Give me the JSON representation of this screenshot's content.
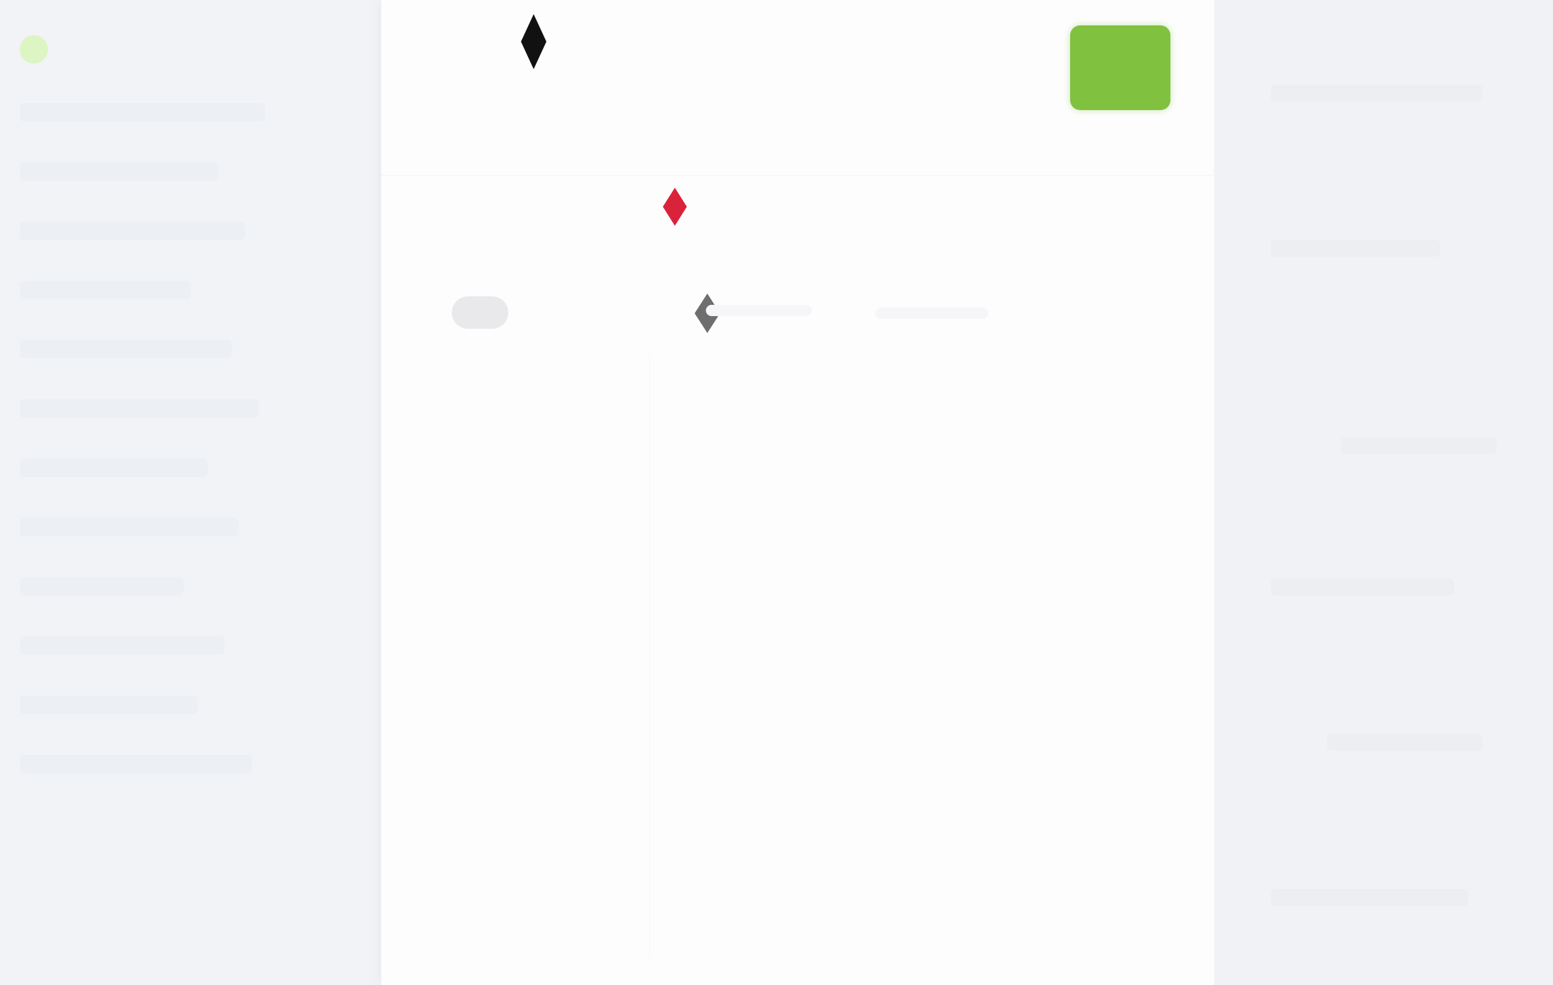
{
  "app": {
    "brand_color": "#d8f5b8"
  },
  "colors": {
    "accent_green": "#80c140",
    "alert_red": "#d9233a",
    "icon_dark": "#111111",
    "icon_gray": "#6e6e6e"
  },
  "icons": {
    "sidebar_brand": "brand-dot-icon",
    "toolbar_command": "diamond-icon",
    "status_alert": "alert-diamond-icon",
    "settings": "settings-diamond-icon"
  },
  "main": {
    "primary_action": {
      "label": ""
    },
    "toggle": {
      "label": ""
    }
  }
}
